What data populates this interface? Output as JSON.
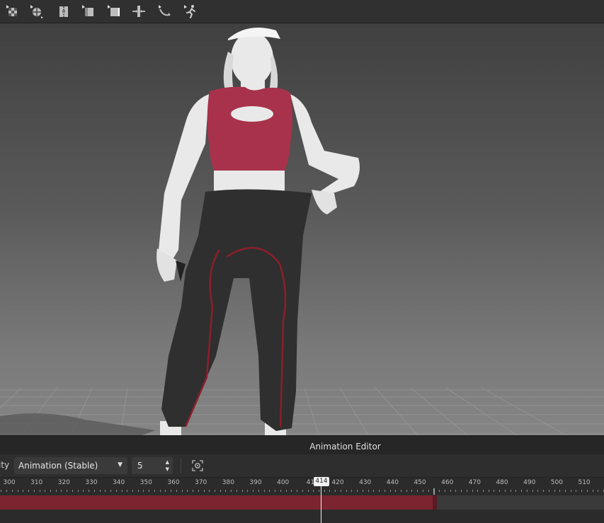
{
  "toolbar": {
    "tools": [
      {
        "name": "simulate-icon"
      },
      {
        "name": "transform-pattern-icon"
      },
      {
        "name": "zipper-icon"
      },
      {
        "name": "edit-pattern-icon"
      },
      {
        "name": "transform-pattern-3d-icon"
      },
      {
        "name": "pin-icon"
      },
      {
        "name": "rotate-avatar-icon"
      },
      {
        "name": "avatar-motion-icon"
      }
    ]
  },
  "animation_editor": {
    "title": "Animation Editor",
    "quality_label": "ity",
    "mode": "Animation (Stable)",
    "step": "5",
    "ruler": {
      "labels": [
        "300",
        "310",
        "320",
        "330",
        "340",
        "350",
        "360",
        "370",
        "380",
        "390",
        "400",
        "41",
        "420",
        "430",
        "440",
        "450",
        "460",
        "470",
        "480",
        "490",
        "500",
        "510"
      ],
      "first": 300,
      "last": 510
    },
    "current_frame": "414",
    "clip_end_frame": 457
  },
  "colors": {
    "clip": "#7b2531",
    "top_garment": "#a8324b",
    "pants": "#2f2f2f",
    "seam": "#8b1f2b"
  }
}
